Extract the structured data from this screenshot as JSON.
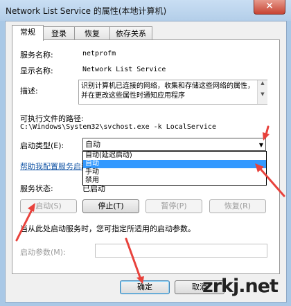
{
  "window": {
    "title": "Network List Service 的属性(本地计算机)",
    "close": "✕"
  },
  "tabs": [
    {
      "label": "常规"
    },
    {
      "label": "登录"
    },
    {
      "label": "恢复"
    },
    {
      "label": "依存关系"
    }
  ],
  "general": {
    "service_name_label": "服务名称:",
    "service_name_value": "netprofm",
    "display_name_label": "显示名称:",
    "display_name_value": "Network List Service",
    "description_label": "描述:",
    "description_value": "识别计算机已连接的网络，收集和存储这些网络的属性，并在更改这些属性时通知应用程序",
    "exec_path_label": "可执行文件的路径:",
    "exec_path_value": "C:\\Windows\\System32\\svchost.exe -k LocalService",
    "startup_type_label": "启动类型(E):",
    "startup_type_value": "自动",
    "startup_options": [
      "自动(延迟启动)",
      "自动",
      "手动",
      "禁用"
    ],
    "help_link": "帮助我配置服务启动",
    "status_label": "服务状态:",
    "status_value": "已启动",
    "buttons": {
      "start": "启动(S)",
      "stop": "停止(T)",
      "pause": "暂停(P)",
      "resume": "恢复(R)"
    },
    "hint": "当从此处启动服务时，您可指定所适用的启动参数。",
    "params_label": "启动参数(M):",
    "params_value": ""
  },
  "footer": {
    "ok": "确定",
    "cancel": "取消"
  },
  "watermark": "zrkj.net",
  "colors": {
    "annotation_arrow": "#e8423c",
    "selection": "#3399ff",
    "link": "#1a5aa8"
  }
}
